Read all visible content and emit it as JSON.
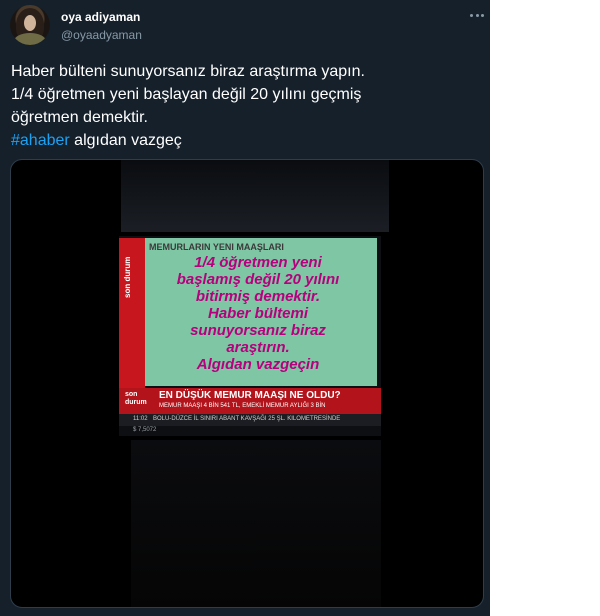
{
  "user": {
    "display_name": "oya adiyaman",
    "handle": "@oyaadyaman",
    "avatar_icon": "profile-photo"
  },
  "tweet": {
    "lines": [
      "Haber bülteni sunuyorsanız biraz araştırma yapın.",
      "1/4 öğretmen yeni başlayan değil 20 yılını geçmiş",
      "öğretmen demektir."
    ],
    "hashtag": "#ahaber",
    "after_hashtag": " algıdan vazgeç"
  },
  "video": {
    "tv_header": "MEMURLARIN YENI MAAŞLARI",
    "side_label": "son durum",
    "overlay_lines": [
      "1/4 öğretmen yeni",
      "başlamış değil 20 yılını",
      "bitirmiş demektir.",
      "Haber bültemi",
      "sunuyorsanız biraz",
      "araştırın.",
      "Algıdan vazgeçin"
    ],
    "ticker_logo_line1": "son",
    "ticker_logo_line2": "durum",
    "ticker_headline": "EN DÜŞÜK MEMUR MAAŞI NE OLDU?",
    "ticker_subline": "MEMUR MAAŞI 4 BİN 541 TL, EMEKLİ MEMUR AYLIĞI 3 BİN",
    "ticker_time": "11:02",
    "ticker_crawl": "BOLU-DÜZCE İL SINIRI ABANT KAVŞAĞI 25 ŞL. KILOMETRESİNDE",
    "ticker_rate": "$ 7,5072"
  },
  "colors": {
    "background": "#15202b",
    "hashtag": "#1da1f2",
    "overlay_text": "#b6007e",
    "tv_red": "#c8161e"
  }
}
